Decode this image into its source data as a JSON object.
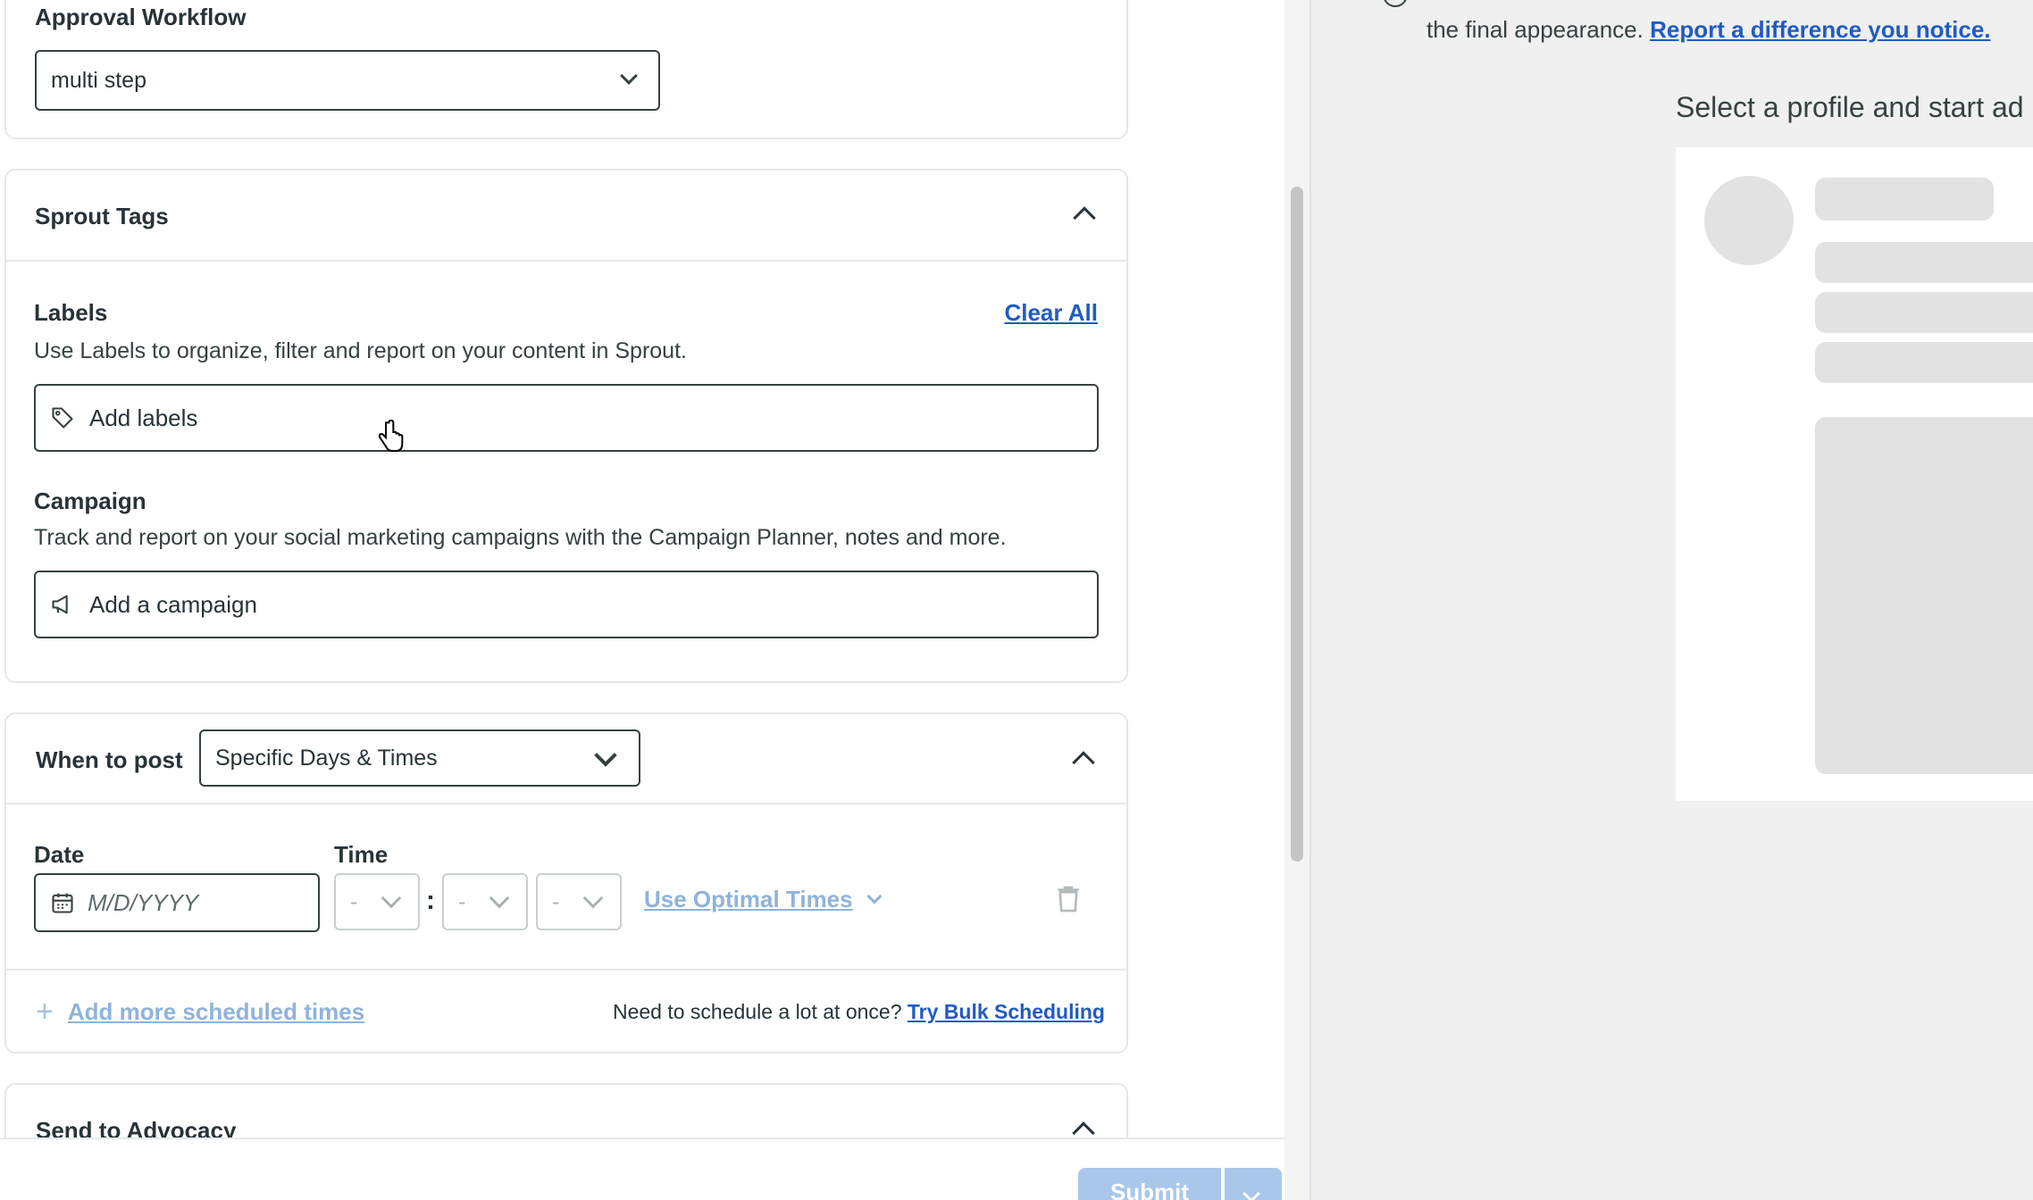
{
  "approval": {
    "title": "Approval Workflow",
    "selected": "multi step"
  },
  "sprout_tags": {
    "title": "Sprout Tags",
    "labels_heading": "Labels",
    "clear_all": "Clear All",
    "labels_desc": "Use Labels to organize, filter and report on your content in Sprout.",
    "labels_placeholder": "Add labels",
    "campaign_heading": "Campaign",
    "campaign_desc": "Track and report on your social marketing campaigns with the Campaign Planner, notes and more.",
    "campaign_placeholder": "Add a campaign"
  },
  "when_to_post": {
    "title": "When to post",
    "selected": "Specific Days & Times",
    "date_label": "Date",
    "time_label": "Time",
    "date_placeholder": "M/D/YYYY",
    "hour": "-",
    "minute": "-",
    "ampm": "-",
    "colon": ":",
    "optimal_times": "Use Optimal Times",
    "add_more": "Add more scheduled times",
    "bulk_prompt": "Need to schedule a lot at once?",
    "bulk_link": "Try Bulk Scheduling"
  },
  "advocacy": {
    "title": "Send to Advocacy"
  },
  "footer": {
    "submit": "Submit"
  },
  "preview": {
    "note_text": "the final appearance.",
    "report_link": "Report a difference you notice.",
    "prompt": "Select a profile and start ad"
  },
  "colors": {
    "link": "#205bc3",
    "muted_link": "#8fb3d9",
    "submit_bg": "#a8c7ea",
    "preview_bg": "#f0f0f0"
  }
}
